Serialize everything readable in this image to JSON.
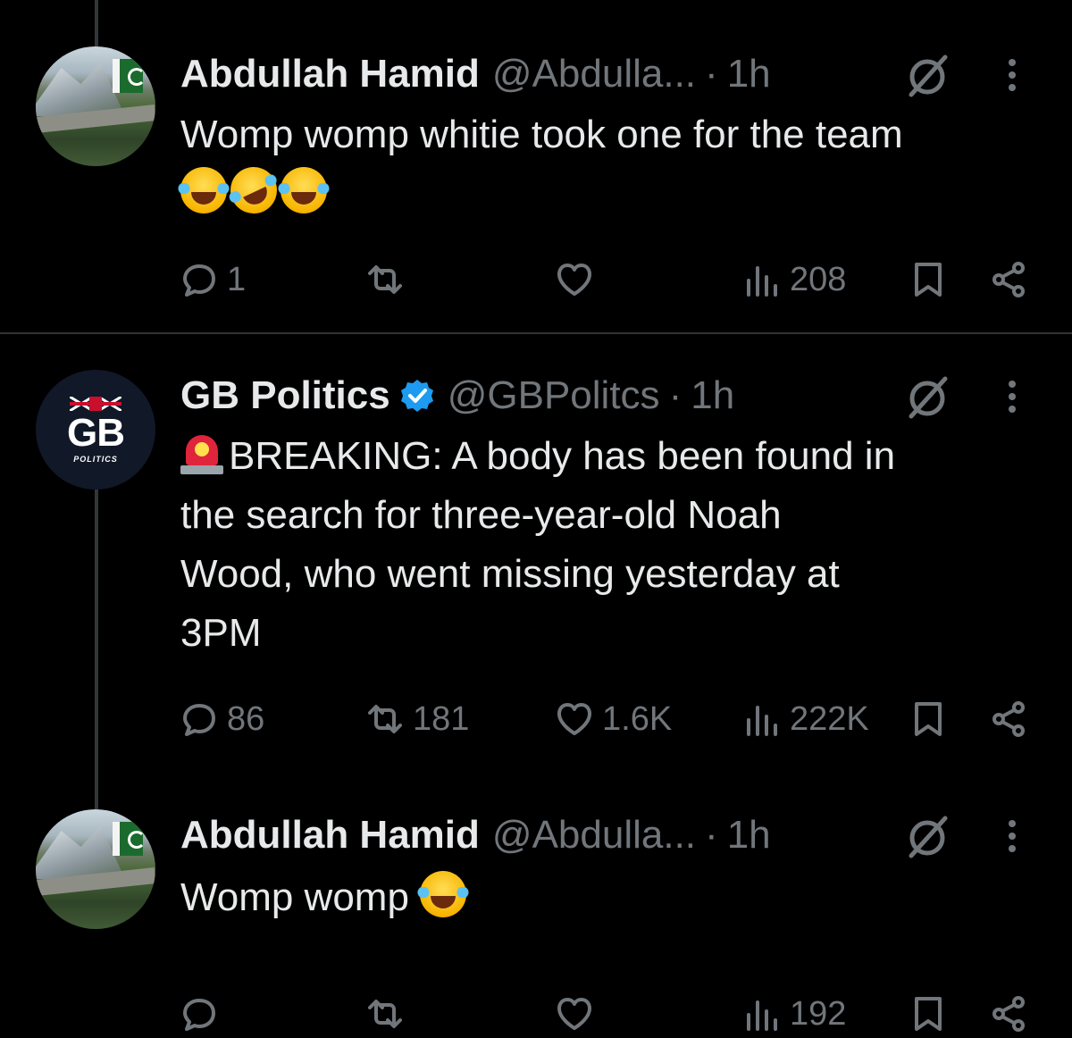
{
  "tweets": [
    {
      "name": "Abdullah Hamid",
      "handle": "@Abdulla...",
      "separator": "·",
      "time": "1h",
      "text": "Womp womp whitie took one for the team",
      "emojis": [
        "face-with-tears-of-joy",
        "rolling-on-the-floor-laughing",
        "face-with-tears-of-joy"
      ],
      "replies": "1",
      "retweets": "",
      "likes": "",
      "views": "208"
    },
    {
      "name": "GB Politics",
      "verified": true,
      "handle": "@GBPolitcs",
      "separator": "·",
      "time": "1h",
      "lead_emoji": "police-car-light",
      "text_lines": [
        "BREAKING: A body has been found in",
        "the search for three-year-old Noah",
        "Wood, who went missing yesterday at",
        "3PM"
      ],
      "avatar_text": "GB",
      "avatar_subtext": "POLITICS",
      "replies": "86",
      "retweets": "181",
      "likes": "1.6K",
      "views": "222K"
    },
    {
      "name": "Abdullah Hamid",
      "handle": "@Abdulla...",
      "separator": "·",
      "time": "1h",
      "text": "Womp womp",
      "emojis": [
        "face-with-tears-of-joy"
      ],
      "replies": "",
      "retweets": "",
      "likes": "",
      "views": "192"
    }
  ],
  "colors": {
    "background": "#000000",
    "text": "#e7e9ea",
    "muted": "#71767b",
    "verified": "#1d9bf0",
    "divider": "#2f3336"
  }
}
